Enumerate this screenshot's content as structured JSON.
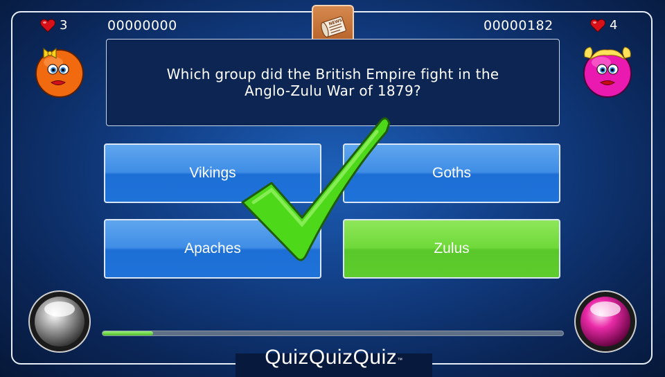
{
  "players": [
    {
      "lives": "3",
      "score": "00000000",
      "avatar": "orange-girl-avatar"
    },
    {
      "lives": "4",
      "score": "00000182",
      "avatar": "pink-girl-avatar"
    }
  ],
  "question": "Which group did the British Empire fight in the Anglo-Zulu War of 1879?",
  "answers": [
    {
      "label": "Vikings",
      "state": "normal"
    },
    {
      "label": "Goths",
      "state": "normal"
    },
    {
      "label": "Apaches",
      "state": "normal"
    },
    {
      "label": "Zulus",
      "state": "correct"
    }
  ],
  "feedback_icon": "checkmark-icon",
  "category_icon": "newspaper-icon",
  "category_icon_text": "NEWS",
  "timer_progress": 0.11,
  "brand": {
    "name": "QuizQuizQuiz",
    "trademark": "™"
  },
  "colors": {
    "answer_blue": "#3f8de6",
    "answer_correct": "#6fd93a",
    "checkmark_green": "#4ed81a",
    "player1": "#f2660f",
    "player2": "#e01aa8"
  }
}
